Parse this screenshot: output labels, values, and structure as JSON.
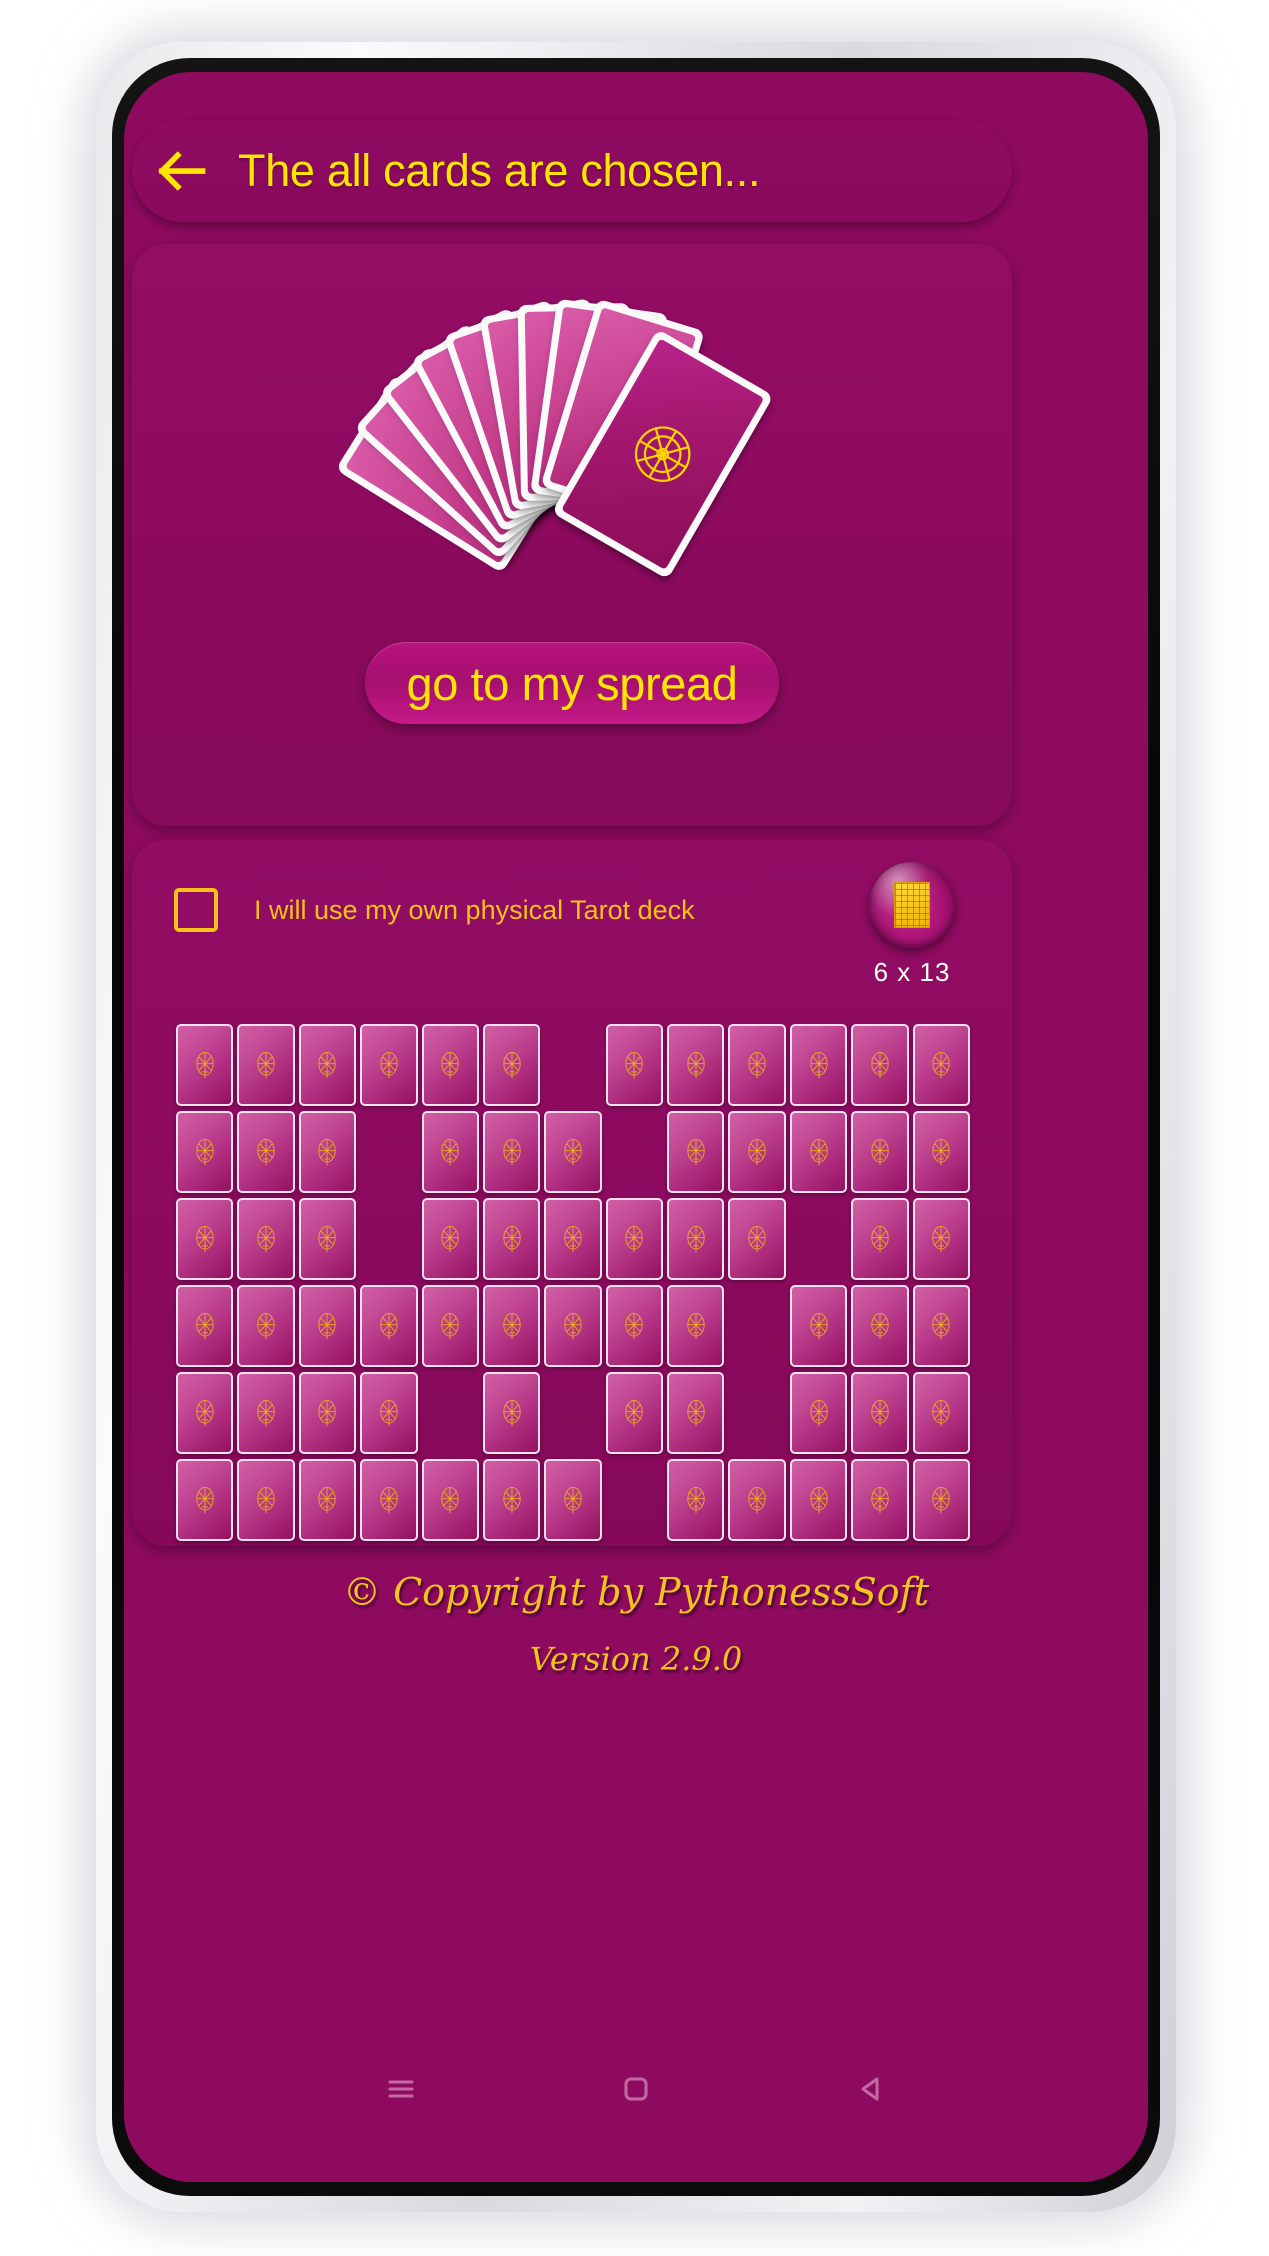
{
  "app": {
    "background_color": "#8d0a5f",
    "accent_yellow": "#ffe500",
    "accent_gold": "#f5c21a"
  },
  "app_bar": {
    "title": "The all cards are chosen...",
    "back_icon": "arrow-left-icon"
  },
  "hero": {
    "fan_icon": "tarot-card-fan-icon",
    "emblem_icon": "wheel-of-fortune-icon",
    "cta_label": "go to my spread"
  },
  "selection": {
    "own_deck_label": "I will use my own physical Tarot deck",
    "own_deck_checked": false,
    "grid_size_label": "6 x 13",
    "grid_size_icon": "grid-layout-icon",
    "grid": {
      "rows": 6,
      "cols": 13,
      "card_back_icon": "tarot-card-back-icon",
      "present": [
        [
          1,
          1,
          1,
          1,
          1,
          1,
          0,
          1,
          1,
          1,
          1,
          1,
          1
        ],
        [
          1,
          1,
          1,
          0,
          1,
          1,
          1,
          0,
          1,
          1,
          1,
          1,
          1
        ],
        [
          1,
          1,
          1,
          0,
          1,
          1,
          1,
          1,
          1,
          1,
          0,
          1,
          1
        ],
        [
          1,
          1,
          1,
          1,
          1,
          1,
          1,
          1,
          1,
          0,
          1,
          1,
          1
        ],
        [
          1,
          1,
          1,
          1,
          0,
          1,
          0,
          1,
          1,
          0,
          1,
          1,
          1
        ],
        [
          1,
          1,
          1,
          1,
          1,
          1,
          1,
          0,
          1,
          1,
          1,
          1,
          1
        ]
      ]
    }
  },
  "footer": {
    "copyright": "© Copyright by PythonessSoft",
    "version": "Version 2.9.0"
  },
  "nav_bar": {
    "recents_icon": "menu-icon",
    "home_icon": "home-square-icon",
    "back_icon": "back-triangle-icon"
  }
}
